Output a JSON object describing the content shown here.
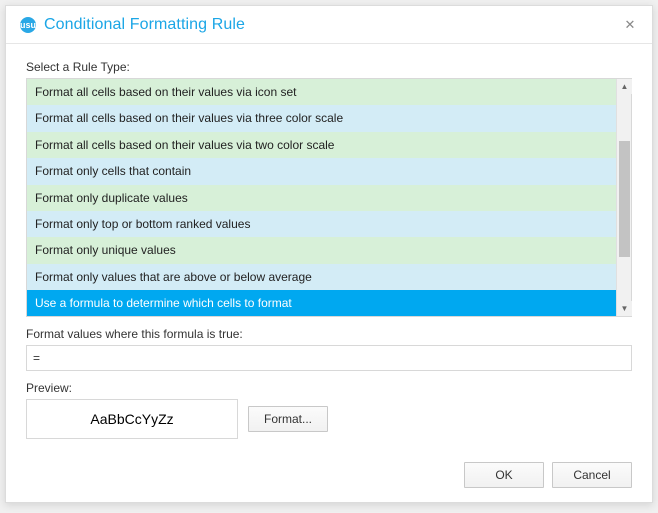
{
  "title": "Conditional Formatting Rule",
  "appIconText": "usu",
  "labels": {
    "selectRuleType": "Select a Rule Type:",
    "formulaTrue": "Format values where this formula is true:",
    "preview": "Preview:"
  },
  "ruleTypes": [
    {
      "label": "Format all cells based on their values via icon set",
      "shade": "green",
      "selected": false
    },
    {
      "label": "Format all cells based on their values via three color scale",
      "shade": "blue",
      "selected": false
    },
    {
      "label": "Format all cells based on their values via two color scale",
      "shade": "green",
      "selected": false
    },
    {
      "label": "Format only cells that contain",
      "shade": "blue",
      "selected": false
    },
    {
      "label": "Format only duplicate values",
      "shade": "green",
      "selected": false
    },
    {
      "label": "Format only top or bottom ranked values",
      "shade": "blue",
      "selected": false
    },
    {
      "label": "Format only unique values",
      "shade": "green",
      "selected": false
    },
    {
      "label": "Format only values that are above or below average",
      "shade": "blue",
      "selected": false
    },
    {
      "label": "Use a formula to determine which cells to format",
      "shade": "green",
      "selected": true
    }
  ],
  "formulaValue": "=",
  "previewText": "AaBbCcYyZz",
  "buttons": {
    "format": "Format...",
    "ok": "OK",
    "cancel": "Cancel"
  }
}
